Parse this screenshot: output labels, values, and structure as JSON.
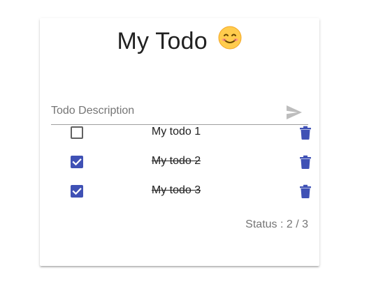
{
  "header": {
    "title": "My Todo",
    "emoji": "smiling-face-icon"
  },
  "input": {
    "placeholder": "Todo Description",
    "value": "",
    "send_icon": "send-icon"
  },
  "todos": [
    {
      "text": "My todo 1",
      "completed": false
    },
    {
      "text": "My todo 2",
      "completed": true
    },
    {
      "text": "My todo 3",
      "completed": true
    }
  ],
  "footer": {
    "status": "Status : 2 / 3"
  },
  "colors": {
    "accent": "#3f51b5",
    "delete": "#3f51b5",
    "text": "#212121",
    "muted": "#757575"
  }
}
